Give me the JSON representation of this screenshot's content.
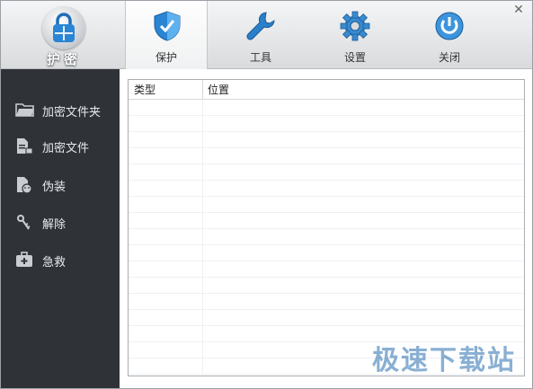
{
  "app": {
    "title": "护密"
  },
  "tabs": [
    {
      "label": "保护",
      "icon": "shield-icon",
      "active": true
    },
    {
      "label": "工具",
      "icon": "wrench-icon",
      "active": false
    },
    {
      "label": "设置",
      "icon": "gear-icon",
      "active": false
    },
    {
      "label": "关闭",
      "icon": "power-icon",
      "active": false
    }
  ],
  "sidebar": {
    "items": [
      {
        "label": "加密文件夹",
        "icon": "folder-icon"
      },
      {
        "label": "加密文件",
        "icon": "file-lock-icon"
      },
      {
        "label": "伪装",
        "icon": "disguise-icon"
      },
      {
        "label": "解除",
        "icon": "key-icon"
      },
      {
        "label": "急救",
        "icon": "first-aid-icon"
      }
    ]
  },
  "list": {
    "columns": [
      "类型",
      "位置"
    ],
    "rows": []
  },
  "watermark": "极速下载站",
  "colors": {
    "accent_blue": "#2a7fc9",
    "sidebar_bg": "#2f3338",
    "toolbar_top": "#f4f5f6",
    "toolbar_bottom": "#d9dbdd"
  }
}
